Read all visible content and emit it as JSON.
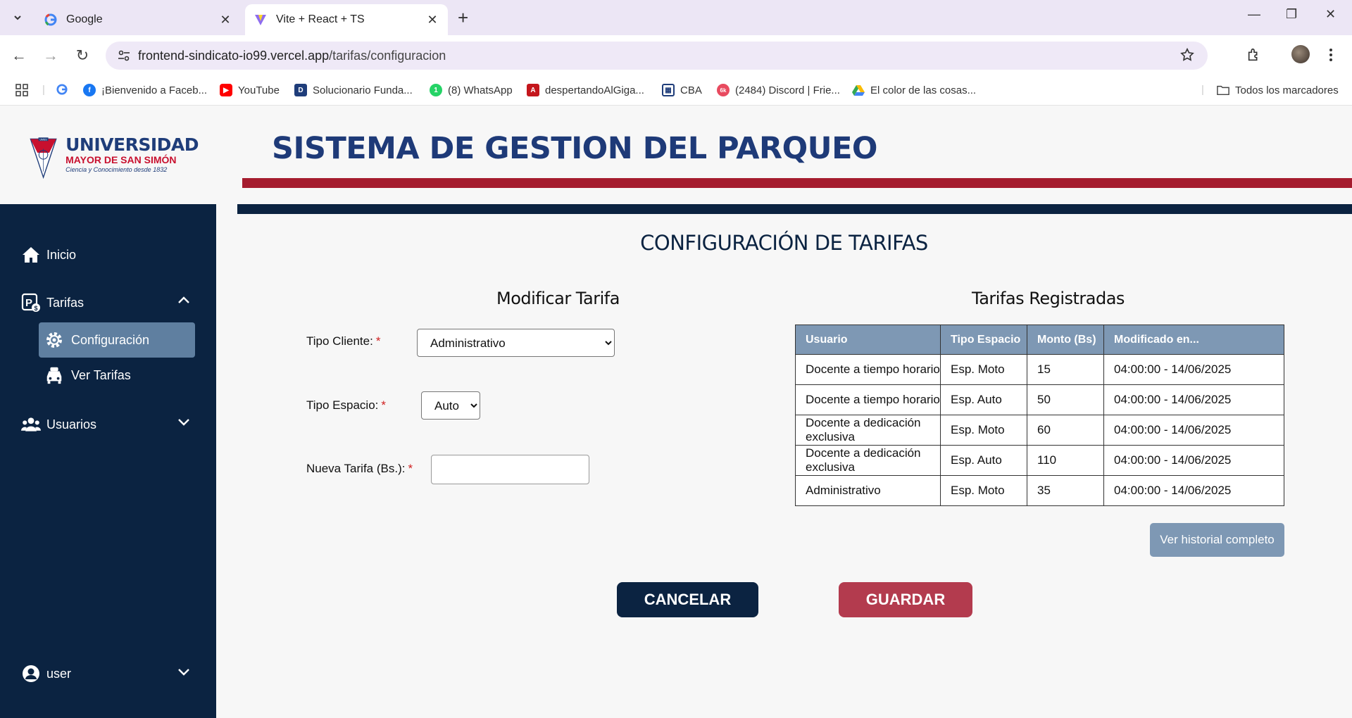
{
  "browser": {
    "tabs": [
      {
        "title": "Google",
        "icon": "google-icon"
      },
      {
        "title": "Vite + React + TS",
        "icon": "vite-icon"
      }
    ],
    "url_host": "frontend-sindicato-io99.vercel.app",
    "url_path": "/tarifas/configuracion",
    "bookmarks": [
      {
        "label": "¡Bienvenido a Faceb...",
        "icon": "facebook-icon"
      },
      {
        "label": "YouTube",
        "icon": "youtube-icon"
      },
      {
        "label": "Solucionario Funda...",
        "icon": "document-icon"
      },
      {
        "label": "(8) WhatsApp",
        "icon": "whatsapp-icon"
      },
      {
        "label": "despertandoAlGiga...",
        "icon": "pdf-icon"
      },
      {
        "label": "CBA",
        "icon": "grid-icon"
      },
      {
        "label": "(2484) Discord | Frie...",
        "icon": "discord-icon"
      },
      {
        "label": "El color de las cosas...",
        "icon": "drive-icon"
      }
    ],
    "all_bookmarks_label": "Todos los marcadores"
  },
  "header": {
    "logo": {
      "line1": "UNIVERSIDAD",
      "line2": "MAYOR DE SAN SIMÓN",
      "line3": "Ciencia y Conocimiento desde 1832",
      "badge": "UMSS"
    },
    "system_title": "SISTEMA DE GESTION DEL PARQUEO"
  },
  "sidebar": {
    "items": [
      {
        "label": "Inicio",
        "icon": "home-icon"
      },
      {
        "label": "Tarifas",
        "icon": "parking-fee-icon"
      },
      {
        "label": "Usuarios",
        "icon": "users-icon"
      }
    ],
    "sub_items": [
      {
        "label": "Configuración",
        "icon": "gear-icon",
        "active": true
      },
      {
        "label": "Ver Tarifas",
        "icon": "car-icon",
        "active": false
      }
    ],
    "user_label": "user"
  },
  "page": {
    "title": "CONFIGURACIÓN DE TARIFAS",
    "form": {
      "title": "Modificar Tarifa",
      "tipo_cliente_label": "Tipo Cliente:",
      "tipo_cliente_value": "Administrativo",
      "tipo_espacio_label": "Tipo Espacio:",
      "tipo_espacio_value": "Auto",
      "nueva_tarifa_label": "Nueva Tarifa (Bs.):",
      "nueva_tarifa_value": "",
      "required_mark": "*"
    },
    "table": {
      "title": "Tarifas Registradas",
      "headers": [
        "Usuario",
        "Tipo Espacio",
        "Monto (Bs)",
        "Modificado en..."
      ],
      "rows": [
        [
          "Docente a tiempo horario",
          "Esp. Moto",
          "15",
          "04:00:00 - 14/06/2025"
        ],
        [
          "Docente a tiempo horario",
          "Esp. Auto",
          "50",
          "04:00:00 - 14/06/2025"
        ],
        [
          "Docente a dedicación exclusiva",
          "Esp. Moto",
          "60",
          "04:00:00 - 14/06/2025"
        ],
        [
          "Docente a dedicación exclusiva",
          "Esp. Auto",
          "110",
          "04:00:00 - 14/06/2025"
        ],
        [
          "Administrativo",
          "Esp. Moto",
          "35",
          "04:00:00 - 14/06/2025"
        ]
      ]
    },
    "buttons": {
      "history": "Ver historial completo",
      "cancel": "CANCELAR",
      "save": "GUARDAR"
    }
  },
  "colors": {
    "navy": "#0b2341",
    "crimson": "#a51c2e",
    "steel": "#7e98b4",
    "save": "#b33b4e"
  }
}
